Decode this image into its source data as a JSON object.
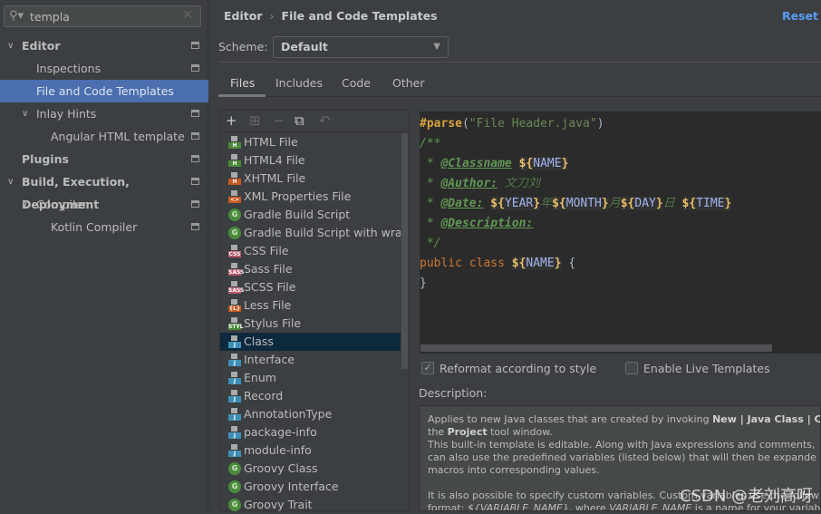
{
  "search": {
    "value": "templa"
  },
  "sidebar": {
    "items": [
      {
        "label": "Editor",
        "bold": true,
        "chev": true,
        "level": 0
      },
      {
        "label": "Inspections",
        "level": 1
      },
      {
        "label": "File and Code Templates",
        "level": 1,
        "selected": true
      },
      {
        "label": "Inlay Hints",
        "chev": true,
        "level": 1
      },
      {
        "label": "Angular HTML template",
        "level": 2
      },
      {
        "label": "Plugins",
        "bold": true,
        "level": 0
      },
      {
        "label": "Build, Execution, Deployment",
        "bold": true,
        "chev": true,
        "level": 0
      },
      {
        "label": "Compiler",
        "chev": true,
        "level": 1
      },
      {
        "label": "Kotlin Compiler",
        "level": 2
      }
    ]
  },
  "breadcrumb": {
    "parent": "Editor",
    "current": "File and Code Templates"
  },
  "reset_label": "Reset",
  "scheme": {
    "label": "Scheme:",
    "value": "Default"
  },
  "tabs": [
    "Files",
    "Includes",
    "Code",
    "Other"
  ],
  "templates": [
    {
      "label": "HTML File",
      "icon": "html",
      "color": "#4a8a3a",
      "tag": "H"
    },
    {
      "label": "HTML4 File",
      "icon": "html",
      "color": "#4a8a3a",
      "tag": "H"
    },
    {
      "label": "XHTML File",
      "icon": "html",
      "color": "#c75a20",
      "tag": "H"
    },
    {
      "label": "XML Properties File",
      "icon": "xml",
      "color": "#c75a20",
      "tag": "<>"
    },
    {
      "label": "Gradle Build Script",
      "icon": "gradle"
    },
    {
      "label": "Gradle Build Script with wrapper",
      "icon": "gradle"
    },
    {
      "label": "CSS File",
      "icon": "css",
      "color": "#b5576a",
      "tag": "CSS"
    },
    {
      "label": "Sass File",
      "icon": "sass",
      "color": "#b5576a",
      "tag": "SASS"
    },
    {
      "label": "SCSS File",
      "icon": "scss",
      "color": "#b5576a",
      "tag": "SASS"
    },
    {
      "label": "Less File",
      "icon": "less",
      "color": "#c75a20",
      "tag": "{L}"
    },
    {
      "label": "Stylus File",
      "icon": "stylus",
      "color": "#4a8a3a",
      "tag": "STYL"
    },
    {
      "label": "Class",
      "icon": "java",
      "color": "#3d8fb5",
      "tag": "J",
      "selected": true
    },
    {
      "label": "Interface",
      "icon": "java",
      "color": "#3d8fb5",
      "tag": "J"
    },
    {
      "label": "Enum",
      "icon": "java",
      "color": "#3d8fb5",
      "tag": "J"
    },
    {
      "label": "Record",
      "icon": "java",
      "color": "#3d8fb5",
      "tag": "J"
    },
    {
      "label": "AnnotationType",
      "icon": "java",
      "color": "#3d8fb5",
      "tag": "J"
    },
    {
      "label": "package-info",
      "icon": "java",
      "color": "#3d8fb5",
      "tag": "J"
    },
    {
      "label": "module-info",
      "icon": "java",
      "color": "#3d8fb5",
      "tag": "J"
    },
    {
      "label": "Groovy Class",
      "icon": "groovy"
    },
    {
      "label": "Groovy Interface",
      "icon": "groovy"
    },
    {
      "label": "Groovy Trait",
      "icon": "groovy"
    }
  ],
  "code": {
    "l1a": "#parse",
    "l1b": "(",
    "l1c": "\"File Header.java\"",
    "l1d": ")",
    "l2": "/**",
    "l3a": " * ",
    "l3b": "@Classname",
    "l3c": " ",
    "l4a": " * ",
    "l4b": "@Author:",
    "l4c": " 文刀刘",
    "l5a": " * ",
    "l5b": "@Date:",
    "l5c": " ",
    "y": "年",
    "m": "月",
    "d": "日 ",
    "l6a": " * ",
    "l6b": "@Description:",
    "l7": " */",
    "l8a": "public class ",
    "l8b": " ",
    "l8c": "{",
    "l9": "}",
    "vars": {
      "NAME": "NAME",
      "YEAR": "YEAR",
      "MONTH": "MONTH",
      "DAY": "DAY",
      "TIME": "TIME",
      "dollar": "${",
      "close": "}"
    }
  },
  "options": {
    "reformat": {
      "label": "Reformat according to style",
      "checked": true
    },
    "live": {
      "label": "Enable Live Templates",
      "checked": false
    }
  },
  "description": {
    "label": "Description:",
    "l1a": "Applies to new Java classes that are created by invoking ",
    "l1b": "New | Java Class | Cla",
    "l2a": "the ",
    "l2b": "Project",
    "l2c": " tool window.",
    "l3": "This built-in template is editable. Along with Java expressions and comments,",
    "l4": "can also use the predefined variables (listed below) that will then be expande",
    "l5": "macros into corresponding values.",
    "l6": "It is also possible to specify custom variables. Custom variables use the follow",
    "l7a": "format: ",
    "l7b": "${VARIABLE_NAME}",
    "l7c": ", where ",
    "l7d": "VARIABLE_NAME",
    "l7e": " is a name for your variable"
  },
  "watermark": "CSDN @老刘高呀"
}
